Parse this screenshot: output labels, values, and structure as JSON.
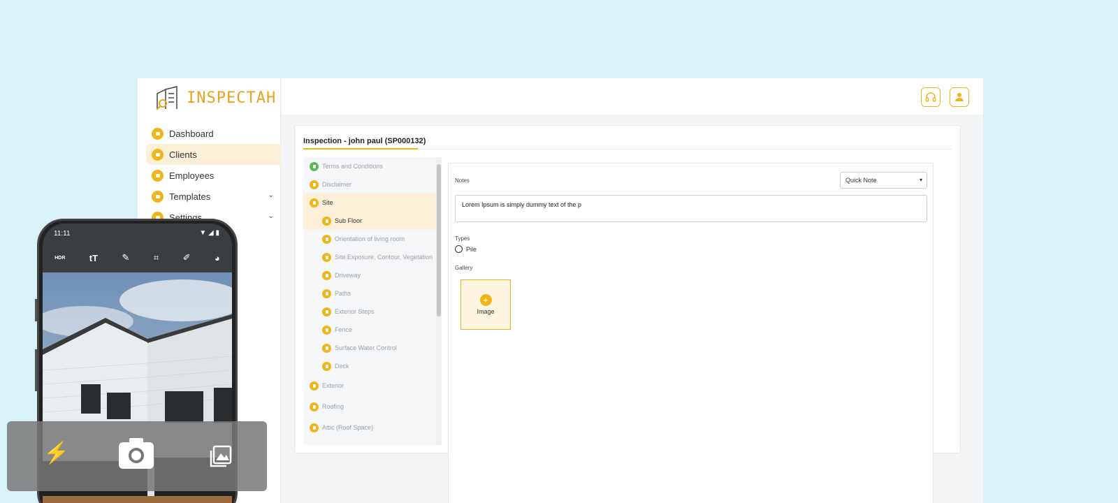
{
  "app": {
    "logo_text": "INSPECTAH",
    "nav": [
      {
        "label": "Dashboard",
        "active": false
      },
      {
        "label": "Clients",
        "active": true
      },
      {
        "label": "Employees",
        "active": false
      },
      {
        "label": "Templates",
        "active": false,
        "expandable": true
      },
      {
        "label": "Settings",
        "active": false,
        "expandable": true
      }
    ],
    "header_icons": [
      "headset-icon",
      "user-icon"
    ]
  },
  "inspection": {
    "title": "Inspection - john paul (SP000132)",
    "tree": [
      {
        "label": "Terms and Conditions",
        "level": 1,
        "icon": "green"
      },
      {
        "label": "Disclaimer",
        "level": 1
      },
      {
        "label": "Site",
        "level": 1,
        "highlight": true
      },
      {
        "label": "Sub Floor",
        "level": 2,
        "highlight": true
      },
      {
        "label": "Orientation of living room",
        "level": 2
      },
      {
        "label": "Site Exposure, Contour, Vegetation",
        "level": 2
      },
      {
        "label": "Driveway",
        "level": 2
      },
      {
        "label": "Paths",
        "level": 2
      },
      {
        "label": "Exterior Steps",
        "level": 2
      },
      {
        "label": "Fence",
        "level": 2
      },
      {
        "label": "Surface Water Control",
        "level": 2
      },
      {
        "label": "Deck",
        "level": 2
      },
      {
        "label": "Exterior",
        "level": 1
      },
      {
        "label": "Roofing",
        "level": 1
      },
      {
        "label": "Attic (Roof Space)",
        "level": 1
      }
    ],
    "form": {
      "notes_label": "Notes",
      "quick_note_value": "Quick Note",
      "notes_text": "Lorem Ipsum is simply dummy text of the p",
      "types_label": "Types",
      "type_option": "Pile",
      "gallery_label": "Gallery",
      "gallery_add_label": "Image"
    }
  },
  "phone": {
    "time": "11:11",
    "toolbar": [
      "HDR",
      "tT",
      "✎",
      "⌗",
      "✐",
      "◕"
    ]
  },
  "colors": {
    "accent": "#f1b51c",
    "highlight": "#fdf0d8"
  }
}
